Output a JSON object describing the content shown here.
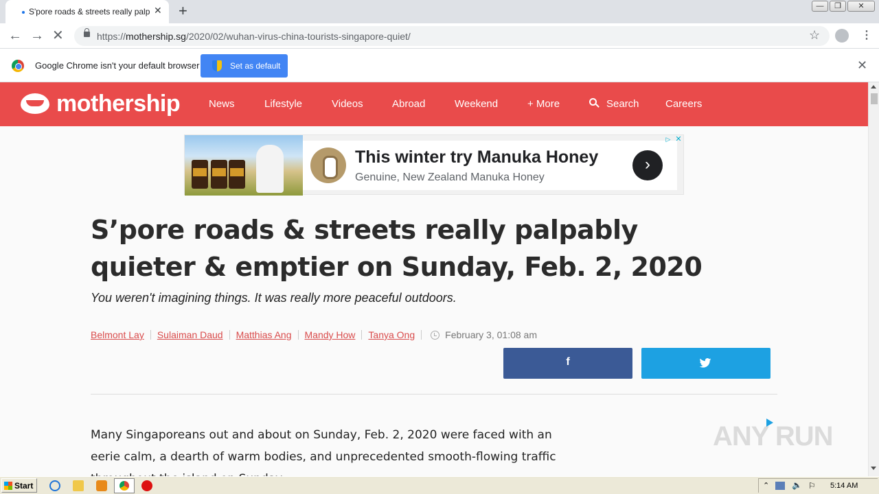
{
  "browser": {
    "tab_title": "S'pore roads & streets really palpably",
    "tab_close": "✕",
    "new_tab": "+",
    "window_controls": {
      "minimize": "—",
      "restore": "❐",
      "close": "✕"
    },
    "url_prefix": "https://",
    "url_host": "mothership.sg",
    "url_path": "/2020/02/wuhan-virus-china-tourists-singapore-quiet/",
    "infobar_message": "Google Chrome isn't your default browser",
    "infobar_button": "Set as default",
    "infobar_close": "✕"
  },
  "site": {
    "logo_text": "mothership",
    "nav": [
      "News",
      "Lifestyle",
      "Videos",
      "Abroad",
      "Weekend",
      "+ More",
      "Search",
      "Careers"
    ]
  },
  "ad": {
    "headline": "This winter try Manuka Honey",
    "subline": "Genuine, New Zealand Manuka Honey",
    "arrow": "›",
    "adchoices": "▷",
    "close": "✕"
  },
  "article": {
    "headline": "S’pore roads & streets really palpably quieter & emptier on Sunday, Feb. 2, 2020",
    "dek": "You weren't imagining things. It was really more peaceful outdoors.",
    "authors": [
      "Belmont Lay",
      "Sulaiman Daud",
      "Matthias Ang",
      "Mandy How",
      "Tanya Ong"
    ],
    "date": "February 3, 01:08 am",
    "share_facebook": "f",
    "body": "Many Singaporeans out and about on Sunday, Feb. 2, 2020 were faced with an eerie calm, a dearth of warm bodies, and unprecedented smooth-flowing traffic throughout the island on Sunday."
  },
  "watermark": "ANY RUN",
  "taskbar": {
    "start_label": "Start",
    "time": "5:14 AM"
  },
  "colors": {
    "brand": "#e94b4b",
    "facebook": "#3b5a96",
    "twitter": "#1da1e2",
    "chrome_blue": "#4285f4"
  }
}
